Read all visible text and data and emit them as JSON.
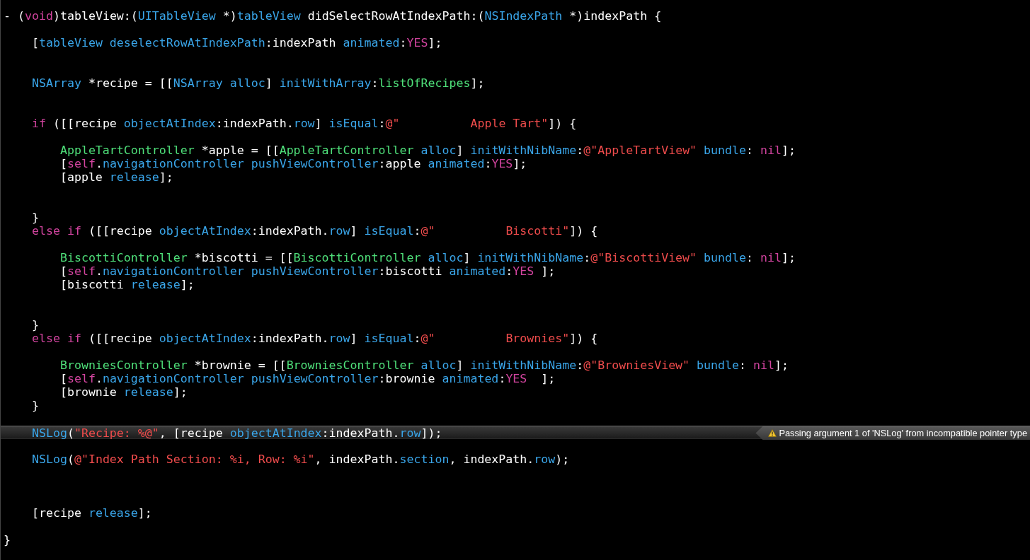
{
  "editor": {
    "lines": [
      {
        "kind": "code",
        "tokens": [
          {
            "kind": "plain",
            "text": "- ("
          },
          {
            "kind": "keyword",
            "text": "void"
          },
          {
            "kind": "plain",
            "text": ")tableView:("
          },
          {
            "kind": "symbol",
            "text": "UITableView"
          },
          {
            "kind": "plain",
            "text": " *)"
          },
          {
            "kind": "symbol",
            "text": "tableView"
          },
          {
            "kind": "plain",
            "text": " didSelectRowAtIndexPath:("
          },
          {
            "kind": "symbol",
            "text": "NSIndexPath"
          },
          {
            "kind": "plain",
            "text": " *)indexPath {"
          }
        ]
      },
      {
        "kind": "blank"
      },
      {
        "kind": "code",
        "tokens": [
          {
            "kind": "plain",
            "text": "    ["
          },
          {
            "kind": "symbol",
            "text": "tableView deselectRowAtIndexPath"
          },
          {
            "kind": "plain",
            "text": ":indexPath "
          },
          {
            "kind": "symbol",
            "text": "animated"
          },
          {
            "kind": "plain",
            "text": ":"
          },
          {
            "kind": "keyword",
            "text": "YES"
          },
          {
            "kind": "plain",
            "text": "];"
          }
        ]
      },
      {
        "kind": "blank"
      },
      {
        "kind": "blank"
      },
      {
        "kind": "code",
        "tokens": [
          {
            "kind": "symbol",
            "text": "    NSArray"
          },
          {
            "kind": "plain",
            "text": " *recipe = [["
          },
          {
            "kind": "symbol",
            "text": "NSArray alloc"
          },
          {
            "kind": "plain",
            "text": "] "
          },
          {
            "kind": "symbol",
            "text": "initWithArray"
          },
          {
            "kind": "plain",
            "text": ":"
          },
          {
            "kind": "project",
            "text": "listOfRecipes"
          },
          {
            "kind": "plain",
            "text": "];"
          }
        ]
      },
      {
        "kind": "blank"
      },
      {
        "kind": "blank"
      },
      {
        "kind": "code",
        "tokens": [
          {
            "kind": "keyword",
            "text": "    if"
          },
          {
            "kind": "plain",
            "text": " ([[recipe "
          },
          {
            "kind": "symbol",
            "text": "objectAtIndex"
          },
          {
            "kind": "plain",
            "text": ":indexPath."
          },
          {
            "kind": "symbol",
            "text": "row"
          },
          {
            "kind": "plain",
            "text": "] "
          },
          {
            "kind": "symbol",
            "text": "isEqual"
          },
          {
            "kind": "plain",
            "text": ":"
          },
          {
            "kind": "string",
            "text": "@\"          Apple Tart\""
          },
          {
            "kind": "plain",
            "text": "]) {"
          }
        ]
      },
      {
        "kind": "blank"
      },
      {
        "kind": "code",
        "tokens": [
          {
            "kind": "project",
            "text": "        AppleTartController"
          },
          {
            "kind": "plain",
            "text": " *apple = [["
          },
          {
            "kind": "project",
            "text": "AppleTartController"
          },
          {
            "kind": "symbol",
            "text": " alloc"
          },
          {
            "kind": "plain",
            "text": "] "
          },
          {
            "kind": "symbol",
            "text": "initWithNibName"
          },
          {
            "kind": "plain",
            "text": ":"
          },
          {
            "kind": "string",
            "text": "@\"AppleTartView\""
          },
          {
            "kind": "symbol",
            "text": " bundle"
          },
          {
            "kind": "plain",
            "text": ": "
          },
          {
            "kind": "keyword",
            "text": "nil"
          },
          {
            "kind": "plain",
            "text": "];"
          }
        ]
      },
      {
        "kind": "code",
        "tokens": [
          {
            "kind": "plain",
            "text": "        ["
          },
          {
            "kind": "keyword",
            "text": "self"
          },
          {
            "kind": "plain",
            "text": "."
          },
          {
            "kind": "symbol",
            "text": "navigationController pushViewController"
          },
          {
            "kind": "plain",
            "text": ":apple "
          },
          {
            "kind": "symbol",
            "text": "animated"
          },
          {
            "kind": "plain",
            "text": ":"
          },
          {
            "kind": "keyword",
            "text": "YES"
          },
          {
            "kind": "plain",
            "text": "];"
          }
        ]
      },
      {
        "kind": "code",
        "tokens": [
          {
            "kind": "plain",
            "text": "        [apple "
          },
          {
            "kind": "symbol",
            "text": "release"
          },
          {
            "kind": "plain",
            "text": "];"
          }
        ]
      },
      {
        "kind": "blank"
      },
      {
        "kind": "blank"
      },
      {
        "kind": "code",
        "tokens": [
          {
            "kind": "plain",
            "text": "    }"
          }
        ]
      },
      {
        "kind": "code",
        "tokens": [
          {
            "kind": "keyword",
            "text": "    else if"
          },
          {
            "kind": "plain",
            "text": " ([[recipe "
          },
          {
            "kind": "symbol",
            "text": "objectAtIndex"
          },
          {
            "kind": "plain",
            "text": ":indexPath."
          },
          {
            "kind": "symbol",
            "text": "row"
          },
          {
            "kind": "plain",
            "text": "] "
          },
          {
            "kind": "symbol",
            "text": "isEqual"
          },
          {
            "kind": "plain",
            "text": ":"
          },
          {
            "kind": "string",
            "text": "@\"          Biscotti\""
          },
          {
            "kind": "plain",
            "text": "]) {"
          }
        ]
      },
      {
        "kind": "blank"
      },
      {
        "kind": "code",
        "tokens": [
          {
            "kind": "project",
            "text": "        BiscottiController"
          },
          {
            "kind": "plain",
            "text": " *biscotti = [["
          },
          {
            "kind": "project",
            "text": "BiscottiController"
          },
          {
            "kind": "symbol",
            "text": " alloc"
          },
          {
            "kind": "plain",
            "text": "] "
          },
          {
            "kind": "symbol",
            "text": "initWithNibName"
          },
          {
            "kind": "plain",
            "text": ":"
          },
          {
            "kind": "string",
            "text": "@\"BiscottiView\""
          },
          {
            "kind": "symbol",
            "text": " bundle"
          },
          {
            "kind": "plain",
            "text": ": "
          },
          {
            "kind": "keyword",
            "text": "nil"
          },
          {
            "kind": "plain",
            "text": "];"
          }
        ]
      },
      {
        "kind": "code",
        "tokens": [
          {
            "kind": "plain",
            "text": "        ["
          },
          {
            "kind": "keyword",
            "text": "self"
          },
          {
            "kind": "plain",
            "text": "."
          },
          {
            "kind": "symbol",
            "text": "navigationController pushViewController"
          },
          {
            "kind": "plain",
            "text": ":biscotti "
          },
          {
            "kind": "symbol",
            "text": "animated"
          },
          {
            "kind": "plain",
            "text": ":"
          },
          {
            "kind": "keyword",
            "text": "YES"
          },
          {
            "kind": "plain",
            "text": " ];"
          }
        ]
      },
      {
        "kind": "code",
        "tokens": [
          {
            "kind": "plain",
            "text": "        [biscotti "
          },
          {
            "kind": "symbol",
            "text": "release"
          },
          {
            "kind": "plain",
            "text": "];"
          }
        ]
      },
      {
        "kind": "blank"
      },
      {
        "kind": "blank"
      },
      {
        "kind": "code",
        "tokens": [
          {
            "kind": "plain",
            "text": "    }"
          }
        ]
      },
      {
        "kind": "code",
        "tokens": [
          {
            "kind": "keyword",
            "text": "    else if"
          },
          {
            "kind": "plain",
            "text": " ([[recipe "
          },
          {
            "kind": "symbol",
            "text": "objectAtIndex"
          },
          {
            "kind": "plain",
            "text": ":indexPath."
          },
          {
            "kind": "symbol",
            "text": "row"
          },
          {
            "kind": "plain",
            "text": "] "
          },
          {
            "kind": "symbol",
            "text": "isEqual"
          },
          {
            "kind": "plain",
            "text": ":"
          },
          {
            "kind": "string",
            "text": "@\"          Brownies\""
          },
          {
            "kind": "plain",
            "text": "]) {"
          }
        ]
      },
      {
        "kind": "blank"
      },
      {
        "kind": "code",
        "tokens": [
          {
            "kind": "project",
            "text": "        BrowniesController"
          },
          {
            "kind": "plain",
            "text": " *brownie = [["
          },
          {
            "kind": "project",
            "text": "BrowniesController"
          },
          {
            "kind": "symbol",
            "text": " alloc"
          },
          {
            "kind": "plain",
            "text": "] "
          },
          {
            "kind": "symbol",
            "text": "initWithNibName"
          },
          {
            "kind": "plain",
            "text": ":"
          },
          {
            "kind": "string",
            "text": "@\"BrowniesView\""
          },
          {
            "kind": "symbol",
            "text": " bundle"
          },
          {
            "kind": "plain",
            "text": ": "
          },
          {
            "kind": "keyword",
            "text": "nil"
          },
          {
            "kind": "plain",
            "text": "];"
          }
        ]
      },
      {
        "kind": "code",
        "tokens": [
          {
            "kind": "plain",
            "text": "        ["
          },
          {
            "kind": "keyword",
            "text": "self"
          },
          {
            "kind": "plain",
            "text": "."
          },
          {
            "kind": "symbol",
            "text": "navigationController pushViewController"
          },
          {
            "kind": "plain",
            "text": ":brownie "
          },
          {
            "kind": "symbol",
            "text": "animated"
          },
          {
            "kind": "plain",
            "text": ":"
          },
          {
            "kind": "keyword",
            "text": "YES"
          },
          {
            "kind": "plain",
            "text": "  ];"
          }
        ]
      },
      {
        "kind": "code",
        "tokens": [
          {
            "kind": "plain",
            "text": "        [brownie "
          },
          {
            "kind": "symbol",
            "text": "release"
          },
          {
            "kind": "plain",
            "text": "];"
          }
        ]
      },
      {
        "kind": "code",
        "tokens": [
          {
            "kind": "plain",
            "text": "    }"
          }
        ]
      },
      {
        "kind": "blank"
      },
      {
        "kind": "code",
        "warning": "Passing argument 1 of 'NSLog' from incompatible pointer type",
        "tokens": [
          {
            "kind": "symbol",
            "text": "    NSLog"
          },
          {
            "kind": "plain",
            "text": "("
          },
          {
            "kind": "string",
            "text": "\"Recipe: %@\""
          },
          {
            "kind": "plain",
            "text": ", [recipe "
          },
          {
            "kind": "symbol",
            "text": "objectAtIndex"
          },
          {
            "kind": "plain",
            "text": ":indexPath."
          },
          {
            "kind": "symbol",
            "text": "row"
          },
          {
            "kind": "plain",
            "text": "]);"
          }
        ]
      },
      {
        "kind": "blank"
      },
      {
        "kind": "code",
        "tokens": [
          {
            "kind": "symbol",
            "text": "    NSLog"
          },
          {
            "kind": "plain",
            "text": "("
          },
          {
            "kind": "string",
            "text": "@\"Index Path Section: %i, Row: %i\""
          },
          {
            "kind": "plain",
            "text": ", indexPath."
          },
          {
            "kind": "symbol",
            "text": "section"
          },
          {
            "kind": "plain",
            "text": ", indexPath."
          },
          {
            "kind": "symbol",
            "text": "row"
          },
          {
            "kind": "plain",
            "text": ");"
          }
        ]
      },
      {
        "kind": "blank"
      },
      {
        "kind": "blank"
      },
      {
        "kind": "blank"
      },
      {
        "kind": "code",
        "tokens": [
          {
            "kind": "plain",
            "text": "    [recipe "
          },
          {
            "kind": "symbol",
            "text": "release"
          },
          {
            "kind": "plain",
            "text": "];"
          }
        ]
      },
      {
        "kind": "blank"
      },
      {
        "kind": "code",
        "tokens": [
          {
            "kind": "plain",
            "text": "}"
          }
        ]
      }
    ]
  }
}
